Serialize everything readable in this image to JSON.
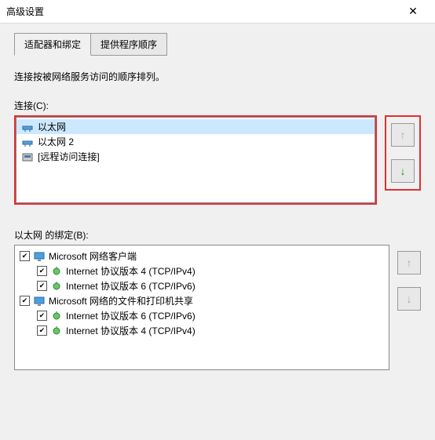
{
  "window": {
    "title": "高级设置"
  },
  "tabs": {
    "adapters": "适配器和绑定",
    "provider": "提供程序顺序"
  },
  "description": "连接按被网络服务访问的顺序排列。",
  "connections": {
    "label": "连接(C):",
    "items": [
      {
        "name": "以太网",
        "type": "adapter",
        "selected": true
      },
      {
        "name": "以太网 2",
        "type": "adapter",
        "selected": false
      },
      {
        "name": "[远程访问连接]",
        "type": "dial",
        "selected": false
      }
    ]
  },
  "bindings": {
    "label": "以太网 的绑定(B):",
    "tree": [
      {
        "name": "Microsoft 网络客户端",
        "checked": true,
        "children": [
          {
            "name": "Internet 协议版本 4 (TCP/IPv4)",
            "checked": true
          },
          {
            "name": "Internet 协议版本 6 (TCP/IPv6)",
            "checked": true
          }
        ]
      },
      {
        "name": "Microsoft 网络的文件和打印机共享",
        "checked": true,
        "children": [
          {
            "name": "Internet 协议版本 6 (TCP/IPv6)",
            "checked": true
          },
          {
            "name": "Internet 协议版本 4 (TCP/IPv4)",
            "checked": true
          }
        ]
      }
    ]
  }
}
